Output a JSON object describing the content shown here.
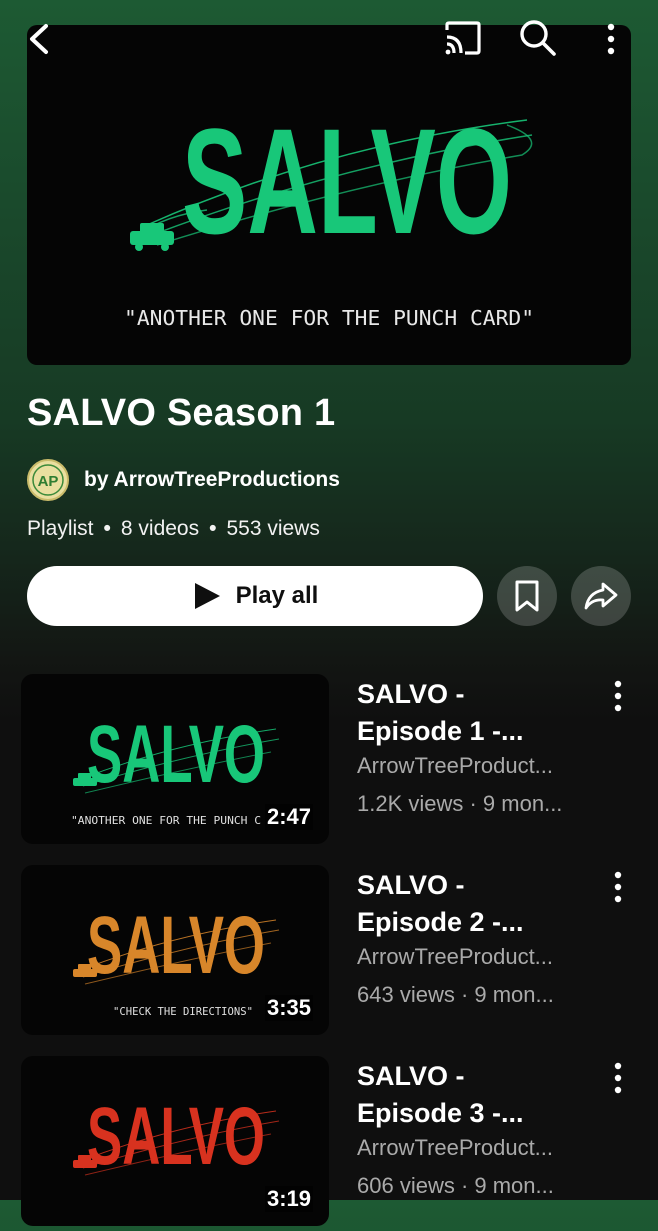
{
  "playlist": {
    "title": "SALVO Season 1",
    "owner_prefix": "by",
    "owner": "ArrowTreeProductions",
    "owner_display": "by ArrowTreeProductions",
    "avatar_text": "AP",
    "type": "Playlist",
    "video_count": "8 videos",
    "views": "553 views",
    "separator": "•"
  },
  "hero": {
    "logo": "SALVO",
    "tagline": "\"ANOTHER ONE FOR THE PUNCH CARD\""
  },
  "actions": {
    "play_all": "Play all"
  },
  "icons": {
    "back": "back-arrow-icon",
    "cast": "cast-icon",
    "search": "search-icon",
    "more": "more-vertical-icon",
    "save": "bookmark-icon",
    "share": "share-icon",
    "play": "play-icon"
  },
  "colors": {
    "ep1": "#18c779",
    "ep2": "#d8862a",
    "ep3": "#d8321f"
  },
  "videos": [
    {
      "title_line1": "SALVO -",
      "title_line2": "Episode 1 -...",
      "channel": "ArrowTreeProduct...",
      "stats": "1.2K views · 9 mon...",
      "duration": "2:47",
      "thumb_logo": "SALVO",
      "thumb_tagline": "\"ANOTHER ONE FOR THE PUNCH C",
      "color": "#18c779"
    },
    {
      "title_line1": "SALVO -",
      "title_line2": "Episode 2 -...",
      "channel": "ArrowTreeProduct...",
      "stats": "643 views · 9 mon...",
      "duration": "3:35",
      "thumb_logo": "SALVO",
      "thumb_tagline": "\"CHECK THE DIRECTIONS\"",
      "color": "#d8862a"
    },
    {
      "title_line1": "SALVO -",
      "title_line2": "Episode 3 -...",
      "channel": "ArrowTreeProduct...",
      "stats": "606 views · 9 mon...",
      "duration": "3:19",
      "thumb_logo": "SALVO",
      "thumb_tagline": "",
      "color": "#d8321f"
    }
  ]
}
